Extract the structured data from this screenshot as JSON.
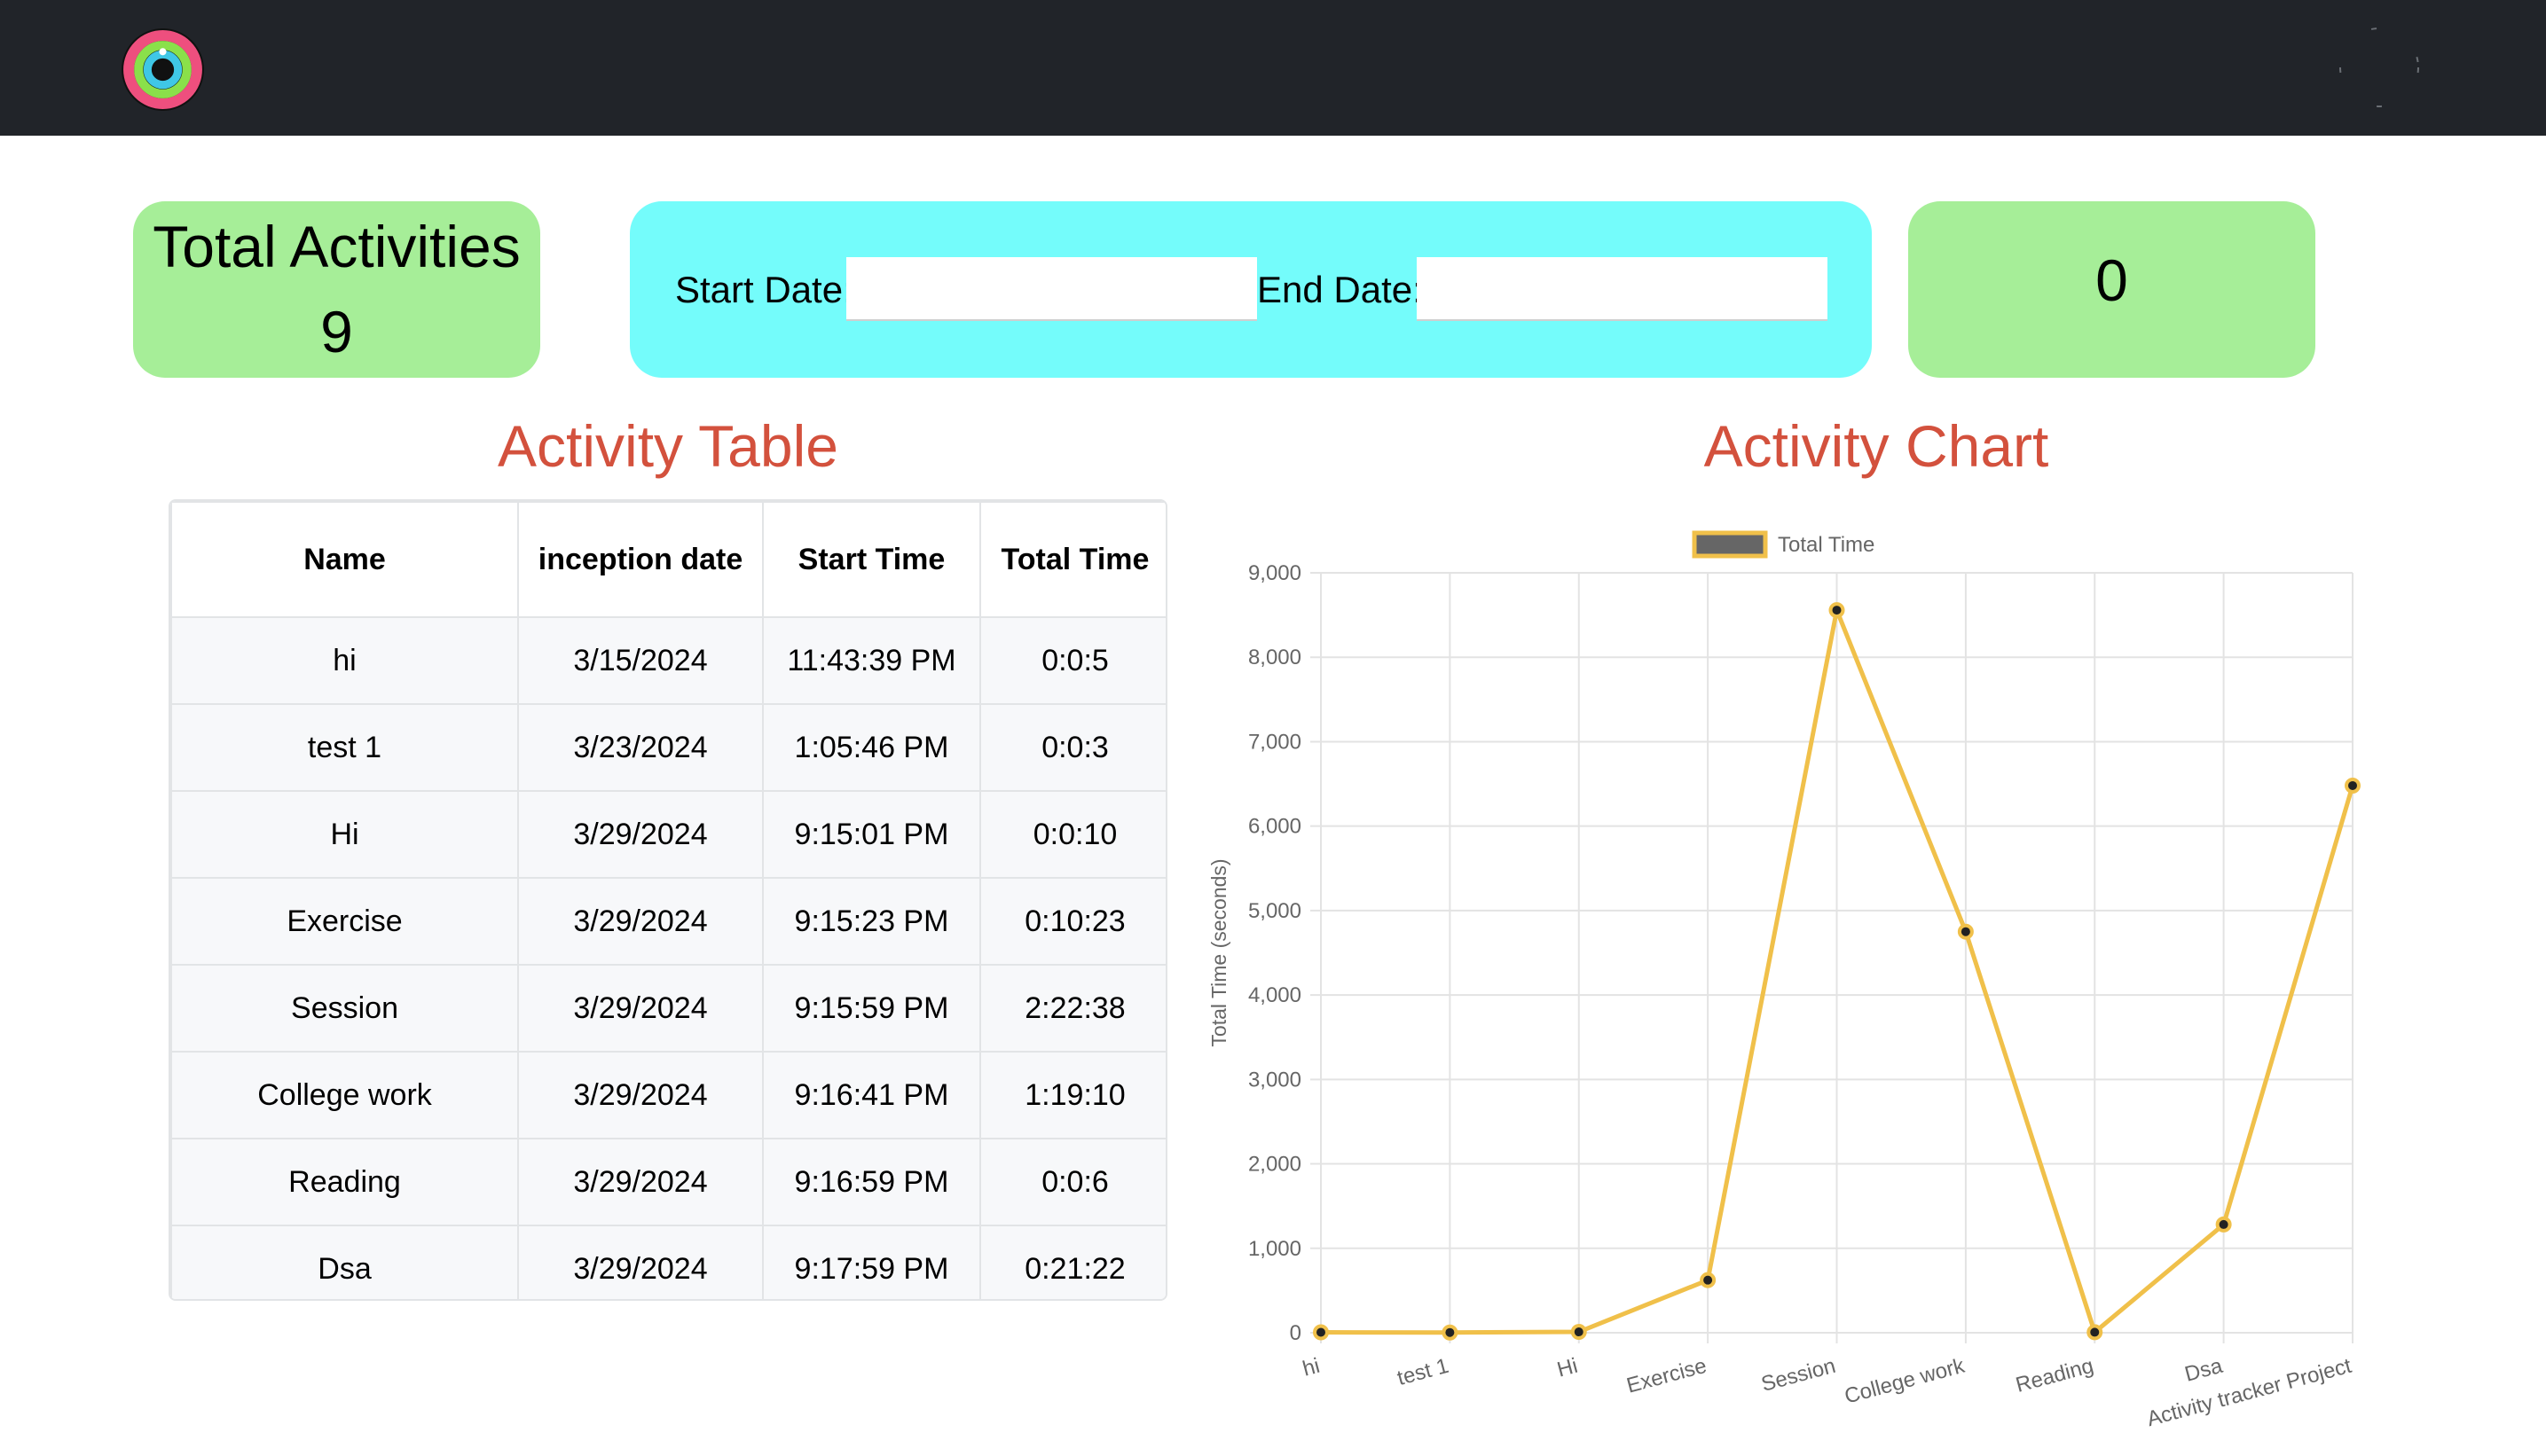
{
  "header": {
    "logo_icon": "activity-rings-logo",
    "menu_icon": "menu-toggle-icon"
  },
  "summary": {
    "label": "Total Activities",
    "count": "9"
  },
  "filters": {
    "start_label": "Start Date:",
    "start_value": "",
    "end_label": "End Date:",
    "end_value": ""
  },
  "timer": {
    "value": "0"
  },
  "table": {
    "title": "Activity Table",
    "columns": [
      "Name",
      "inception date",
      "Start Time",
      "Total Time"
    ],
    "rows": [
      [
        "hi",
        "3/15/2024",
        "11:43:39 PM",
        "0:0:5"
      ],
      [
        "test 1",
        "3/23/2024",
        "1:05:46 PM",
        "0:0:3"
      ],
      [
        "Hi",
        "3/29/2024",
        "9:15:01 PM",
        "0:0:10"
      ],
      [
        "Exercise",
        "3/29/2024",
        "9:15:23 PM",
        "0:10:23"
      ],
      [
        "Session",
        "3/29/2024",
        "9:15:59 PM",
        "2:22:38"
      ],
      [
        "College work",
        "3/29/2024",
        "9:16:41 PM",
        "1:19:10"
      ],
      [
        "Reading",
        "3/29/2024",
        "9:16:59 PM",
        "0:0:6"
      ],
      [
        "Dsa",
        "3/29/2024",
        "9:17:59 PM",
        "0:21:22"
      ]
    ]
  },
  "chart_title": "Activity Chart",
  "chart_data": {
    "type": "line",
    "title": "",
    "categories": [
      "hi",
      "test 1",
      "Hi",
      "Exercise",
      "Session",
      "College work",
      "Reading",
      "Dsa",
      "Activity tracker Project"
    ],
    "series": [
      {
        "name": "Total Time",
        "values": [
          5,
          3,
          10,
          623,
          8558,
          4750,
          6,
          1282,
          6480
        ]
      }
    ],
    "xlabel": "",
    "ylabel": "Total Time (seconds)",
    "ylim": [
      0,
      9000
    ],
    "yticks": [
      "0",
      "1,000",
      "2,000",
      "3,000",
      "4,000",
      "5,000",
      "6,000",
      "7,000",
      "8,000",
      "9,000"
    ],
    "grid": true,
    "legend": "top-center",
    "colors": {
      "line": "#f0c04a",
      "legend_fill": "#666666",
      "point_fill": "#222222",
      "grid": "#e3e3e3"
    }
  }
}
